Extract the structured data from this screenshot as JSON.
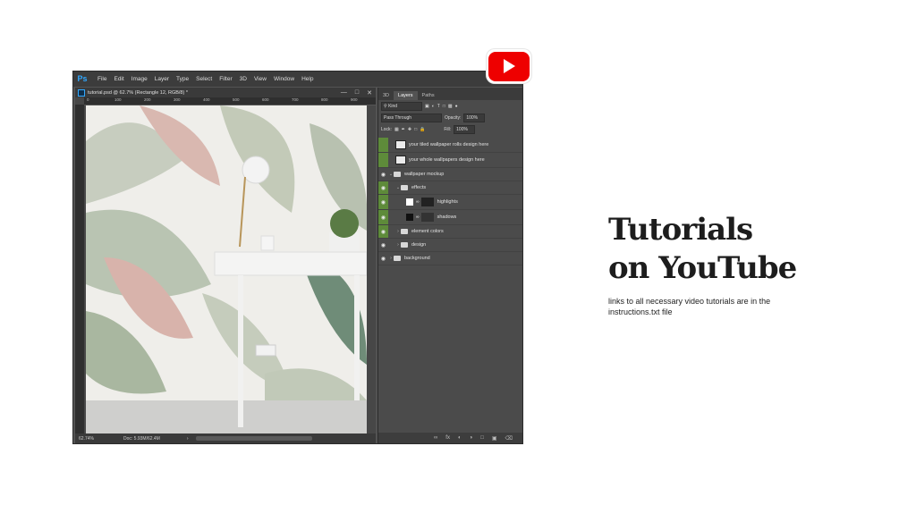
{
  "menu": {
    "logo": "Ps",
    "items": [
      "File",
      "Edit",
      "Image",
      "Layer",
      "Type",
      "Select",
      "Filter",
      "3D",
      "View",
      "Window",
      "Help"
    ]
  },
  "document": {
    "tab_title": "tutorial.psd @ 62.7% (Rectangle 12, RGB/8) *",
    "ruler_marks": [
      "0",
      "100",
      "200",
      "300",
      "400",
      "500",
      "600",
      "700",
      "800",
      "900"
    ],
    "zoom": "62.74%",
    "doc_info": "Doc: 5.93M/62.4M"
  },
  "panels": {
    "tabs": [
      "3D",
      "Layers",
      "Paths"
    ],
    "active_tab": "Layers",
    "filter_kind": "Kind",
    "blend_mode": "Pass Through",
    "opacity_label": "Opacity:",
    "opacity_value": "100%",
    "lock_label": "Lock:",
    "fill_label": "Fill:",
    "fill_value": "100%",
    "layers": [
      {
        "name": "your tiled wallpaper rolls design here",
        "type": "smart"
      },
      {
        "name": "your whole wallpapers design here",
        "type": "smart"
      },
      {
        "name": "wallpaper mockup",
        "type": "folder"
      },
      {
        "name": "effects",
        "type": "folder"
      },
      {
        "name": "highlights",
        "type": "layer"
      },
      {
        "name": "shadows",
        "type": "layer"
      },
      {
        "name": "element colors",
        "type": "folder"
      },
      {
        "name": "design",
        "type": "folder"
      },
      {
        "name": "background",
        "type": "folder"
      }
    ]
  },
  "promo": {
    "title_line1": "Tutorials",
    "title_line2": "on YouTube",
    "subtitle": "links to all necessary video tutorials are in the instructions.txt file"
  },
  "colors": {
    "youtube_red": "#ee0000",
    "layer_green": "#5e8b3a",
    "ps_blue": "#31a8ff"
  }
}
